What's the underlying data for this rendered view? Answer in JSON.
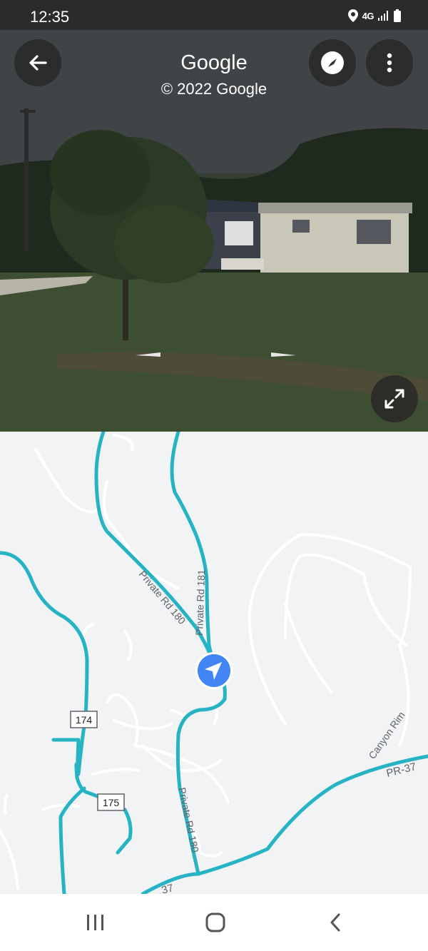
{
  "status_bar": {
    "time": "12:35",
    "network": "4G"
  },
  "street_view": {
    "title": "Google",
    "copyright": "© 2022 Google"
  },
  "map": {
    "labels": {
      "private_rd_181": "Private Rd 181",
      "private_rd_180_upper": "Private Rd 180",
      "private_rd_180_lower": "Private Rd 180",
      "canyon_rim": "Canyon Rim",
      "pr37_right": "PR-37",
      "pr37_left": "37"
    },
    "shields": {
      "route_174": "174",
      "route_175": "175"
    }
  },
  "colors": {
    "road_highlight": "#26b4c4",
    "location_marker": "#4285f4",
    "map_bg": "#f1f3f4"
  },
  "icons": [
    "back-arrow-icon",
    "compass-icon",
    "more-vertical-icon",
    "expand-icon",
    "location-arrow-icon",
    "recent-apps-icon",
    "home-icon",
    "back-icon"
  ]
}
